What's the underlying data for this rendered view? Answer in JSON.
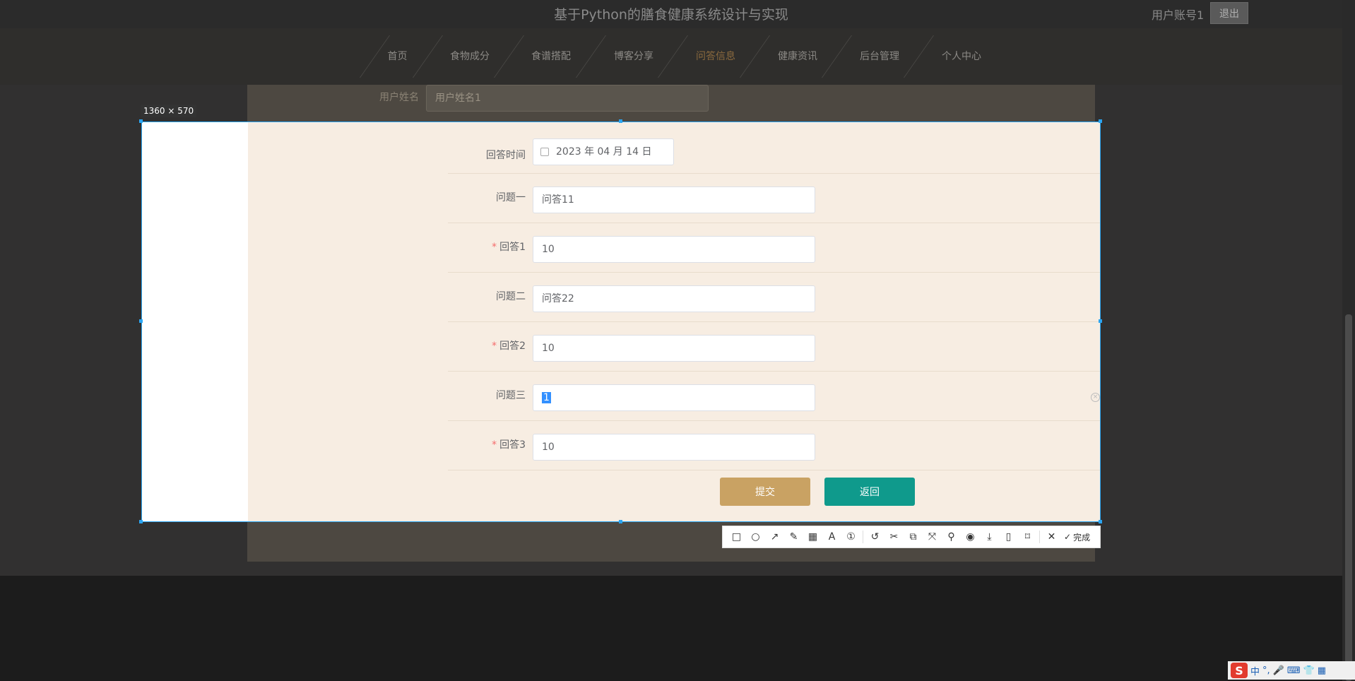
{
  "header": {
    "site_title": "基于Python的膳食健康系统设计与实现",
    "user_name": "用户账号1",
    "logout_label": "退出"
  },
  "nav": {
    "items": [
      {
        "label": "首页"
      },
      {
        "label": "食物成分"
      },
      {
        "label": "食谱搭配"
      },
      {
        "label": "博客分享"
      },
      {
        "label": "问答信息",
        "active": true
      },
      {
        "label": "健康资讯"
      },
      {
        "label": "后台管理"
      },
      {
        "label": "个人中心"
      }
    ]
  },
  "form": {
    "username_label": "用户姓名",
    "username_value": "用户姓名1",
    "answer_time_label": "回答时间",
    "answer_time_value": "2023 年 04 月 14 日",
    "q1_label": "问题一",
    "q1_value": "问答11",
    "a1_label": "回答1",
    "a1_value": "10",
    "q2_label": "问题二",
    "q2_value": "问答22",
    "a2_label": "回答2",
    "a2_value": "10",
    "q3_label": "问题三",
    "q3_value": "1",
    "a3_label": "回答3",
    "a3_value": "10",
    "required_mark": "*",
    "submit_label": "提交",
    "back_label": "返回"
  },
  "capture": {
    "size_label": "1360 × 570",
    "done_label": "完成"
  },
  "ime": {
    "logo": "S",
    "mode": "中"
  },
  "colors": {
    "accent_gold": "#c9a263",
    "accent_teal": "#0f9a8c",
    "selection_blue": "#2aa5f2",
    "panel_bg": "#f7ede2"
  }
}
